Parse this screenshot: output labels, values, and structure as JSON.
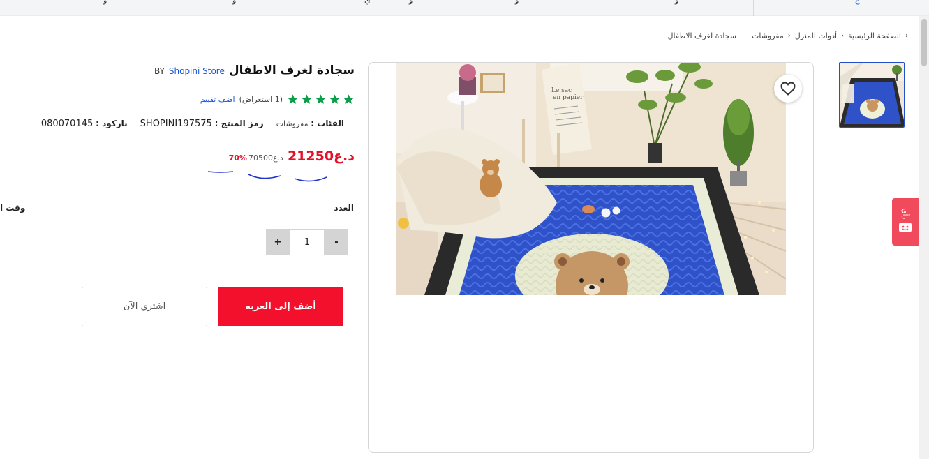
{
  "topnav": {
    "items": [
      "و",
      "و",
      "ي",
      "و",
      "و",
      "و",
      "و"
    ],
    "right_item": "ع"
  },
  "breadcrumb": {
    "home": "الصفحة الرئيسية",
    "category": "أدوات المنزل",
    "subcategory": "مفروشات",
    "current": "سجادة لغرف الاطفال"
  },
  "product": {
    "title": "سجادة لغرف الاطفال",
    "by_label": "BY",
    "store": "Shopini Store",
    "rating_stars": 5,
    "reviews": "(1 استعراض)",
    "add_review": "اضف تقييم",
    "category_label": "الفئات :",
    "category_value": "مفروشات",
    "sku_label": "رمز المنتج :",
    "sku_value": "SHOPINI197575",
    "barcode_label": "باركود :",
    "barcode_value": "080070145",
    "price": "21250",
    "currency": "د.ع",
    "old_price": "70500",
    "old_currency": "د.ع",
    "discount": "70%",
    "qty_label": "العدد",
    "qty_value": "1",
    "qty_minus": "-",
    "qty_plus": "+",
    "delivery_label": "وقت ا",
    "add_to_cart": "أضف إلى العربه",
    "buy_now": "اشتري الآن"
  },
  "feedback": {
    "label": "رأي"
  },
  "colors": {
    "accent": "#f2102d",
    "link": "#1a57d6",
    "star": "#0b9f4a",
    "feedback": "#f04a5c"
  }
}
